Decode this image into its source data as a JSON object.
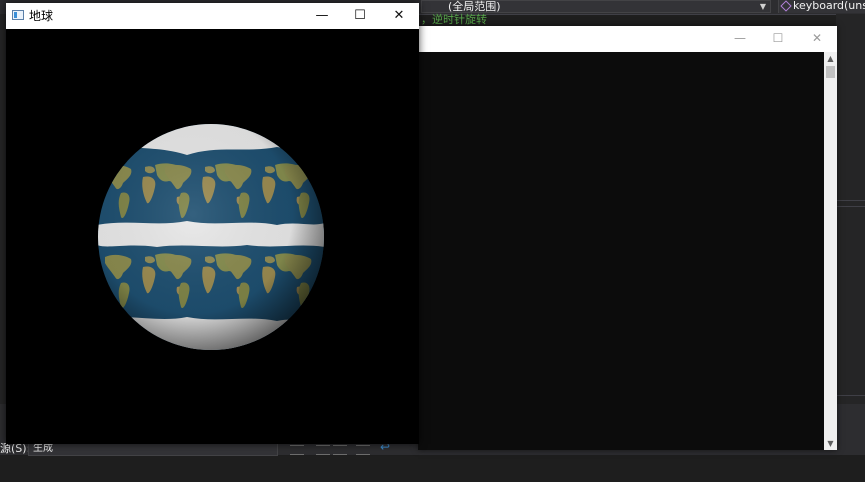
{
  "ide": {
    "scope_value": "(全局范围)",
    "function_value": "keyboard(unsic",
    "code_comment": "，逆时针旋转",
    "output_source_label": "源(S):",
    "output_source_value": "生成"
  },
  "earth_window": {
    "title": "地球",
    "minimize_glyph": "—",
    "maximize_glyph": "☐",
    "close_glyph": "✕",
    "icon": "window-app-icon"
  },
  "console_window": {
    "minimize_glyph": "—",
    "maximize_glyph": "☐",
    "close_glyph": "✕",
    "scroll_up_glyph": "▲",
    "scroll_down_glyph": "▼"
  },
  "scene": {
    "object": "textured-sphere",
    "texture": "world-map",
    "ocean_color": "#1e4f70",
    "land_color": "#8a8a4e",
    "ice_color": "#e6e6e6",
    "background_color": "#000000"
  }
}
